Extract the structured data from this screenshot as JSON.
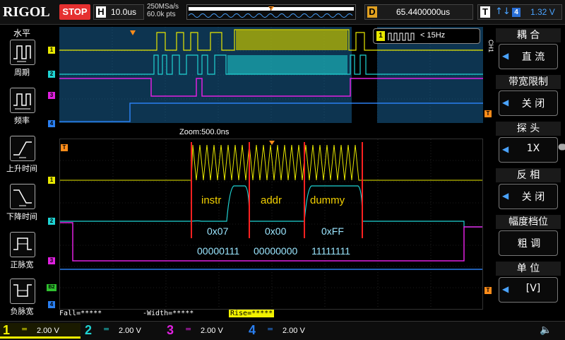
{
  "brand": "RIGOL",
  "run_state": "STOP",
  "timebase": {
    "key": "H",
    "value": "10.0us"
  },
  "sample_rate": "250MSa/s",
  "mem_depth": "60.0k pts",
  "delay": {
    "key": "D",
    "value": "65.4400000us"
  },
  "trigger": {
    "key": "T",
    "edge": "↑↓",
    "source": "4",
    "level": "1.32 V"
  },
  "left_menu": {
    "title": "水平",
    "items": [
      {
        "label": "周期",
        "icon": "period-icon"
      },
      {
        "label": "频率",
        "icon": "frequency-icon"
      },
      {
        "label": "上升时间",
        "icon": "rise-time-icon"
      },
      {
        "label": "下降时间",
        "icon": "fall-time-icon"
      },
      {
        "label": "正脉宽",
        "icon": "positive-width-icon"
      },
      {
        "label": "负脉宽",
        "icon": "negative-width-icon"
      }
    ]
  },
  "right_menu": {
    "channel_tag": "CH1",
    "items": [
      {
        "header": "耦 合",
        "value": "直 流"
      },
      {
        "header": "带宽限制",
        "value": "关 闭"
      },
      {
        "header": "探 头",
        "value": "1X"
      },
      {
        "header": "反 相",
        "value": "关 闭"
      },
      {
        "header": "幅度档位",
        "value": "粗 调"
      },
      {
        "header": "单 位",
        "value": "[V]"
      }
    ]
  },
  "freq_counter": {
    "badge": "1",
    "text": "< 15Hz"
  },
  "zoom_label": "Zoom:500.0ns",
  "channel_markers": {
    "ch1": "1",
    "ch2": "2",
    "ch3": "3",
    "ch4": "4",
    "trig": "T",
    "bus": "B2"
  },
  "annotations": {
    "fields": [
      "instr",
      "addr",
      "dummy"
    ],
    "hex": [
      "0x07",
      "0x00",
      "0xFF"
    ],
    "bin": [
      "00000111",
      "00000000",
      "11111111"
    ]
  },
  "measurements": {
    "fall": "Fall=*****",
    "width": "-Width=*****",
    "rise": "Rise=*****"
  },
  "bottom_channels": [
    {
      "num": "1",
      "coupling": "=",
      "volts": "2.00 V",
      "color": "#f2f200"
    },
    {
      "num": "2",
      "coupling": "=",
      "volts": "2.00 V",
      "color": "#1fd3d3"
    },
    {
      "num": "3",
      "coupling": "=",
      "volts": "2.00 V",
      "color": "#e020e0"
    },
    {
      "num": "4",
      "coupling": "=",
      "volts": "2.00 V",
      "color": "#2a7ff0"
    }
  ],
  "colors": {
    "ch1": "#e8e800",
    "ch2": "#1fd3d3",
    "ch3": "#e020e0",
    "ch4": "#2a7ff0",
    "trigger": "#ff8c1a",
    "marker_line": "#ff2020",
    "annotation_label": "#f2d000",
    "annotation_value": "#9be6ff"
  }
}
